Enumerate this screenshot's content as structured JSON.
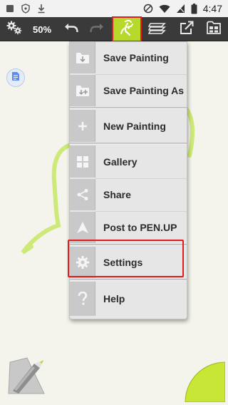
{
  "status_bar": {
    "time": "4:47",
    "icons": [
      "square-icon",
      "shield-icon",
      "download-icon",
      "do-not-disturb-icon",
      "wifi-icon",
      "no-sim-icon",
      "battery-icon"
    ]
  },
  "toolbar": {
    "zoom": "50%",
    "buttons": [
      "settings-gears-icon",
      "undo-icon",
      "redo-icon",
      "painting-menu-icon",
      "layers-icon",
      "export-icon",
      "gallery-icon"
    ],
    "active_button": "painting-menu-icon"
  },
  "menu": {
    "items": [
      {
        "label": "Save Painting",
        "icon": "save-painting-icon"
      },
      {
        "label": "Save Painting As",
        "icon": "save-painting-as-icon"
      },
      {
        "label": "New Painting",
        "icon": "plus-icon"
      },
      {
        "label": "Gallery",
        "icon": "grid-icon"
      },
      {
        "label": "Share",
        "icon": "share-icon"
      },
      {
        "label": "Post to PEN.UP",
        "icon": "penup-icon"
      },
      {
        "label": "Settings",
        "icon": "gear-icon"
      },
      {
        "label": "Help",
        "icon": "question-icon"
      }
    ],
    "highlighted_item": "Settings"
  },
  "colors": {
    "accent": "#b7d92b",
    "toolbar": "#3a3a3a",
    "highlight_border": "#e21c1c",
    "canvas": "#f4f4ec",
    "stroke": "#c9e86a"
  }
}
